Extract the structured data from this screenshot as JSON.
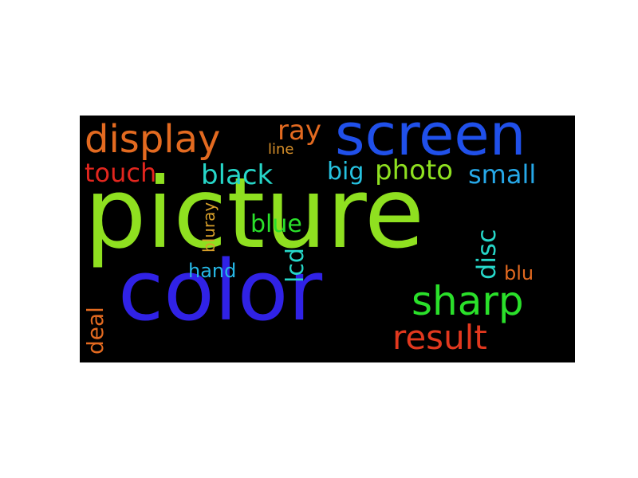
{
  "words": {
    "picture": {
      "text": "picture",
      "color": "#8fe020"
    },
    "color": {
      "text": "color",
      "color": "#3022e6"
    },
    "screen": {
      "text": "screen",
      "color": "#2050ea"
    },
    "display": {
      "text": "display",
      "color": "#e36a20"
    },
    "sharp": {
      "text": "sharp",
      "color": "#2ae02a"
    },
    "result": {
      "text": "result",
      "color": "#e2381e"
    },
    "ray": {
      "text": "ray",
      "color": "#e36a20"
    },
    "line": {
      "text": "line",
      "color": "#d8902a"
    },
    "touch": {
      "text": "touch",
      "color": "#e2261e"
    },
    "black": {
      "text": "black",
      "color": "#26d6c8"
    },
    "big": {
      "text": "big",
      "color": "#26c2e0"
    },
    "photo": {
      "text": "photo",
      "color": "#8fe020"
    },
    "small": {
      "text": "small",
      "color": "#26a8e8"
    },
    "blue": {
      "text": "blue",
      "color": "#2ae02a"
    },
    "hand": {
      "text": "hand",
      "color": "#26b8e6"
    },
    "blu": {
      "text": "blu",
      "color": "#e36a20"
    },
    "deal": {
      "text": "deal",
      "color": "#e36a20"
    },
    "bluray": {
      "text": "bluray",
      "color": "#d8a02a"
    },
    "lcd": {
      "text": "lcd",
      "color": "#26d6c8"
    },
    "disc": {
      "text": "disc",
      "color": "#26d6c8"
    }
  }
}
